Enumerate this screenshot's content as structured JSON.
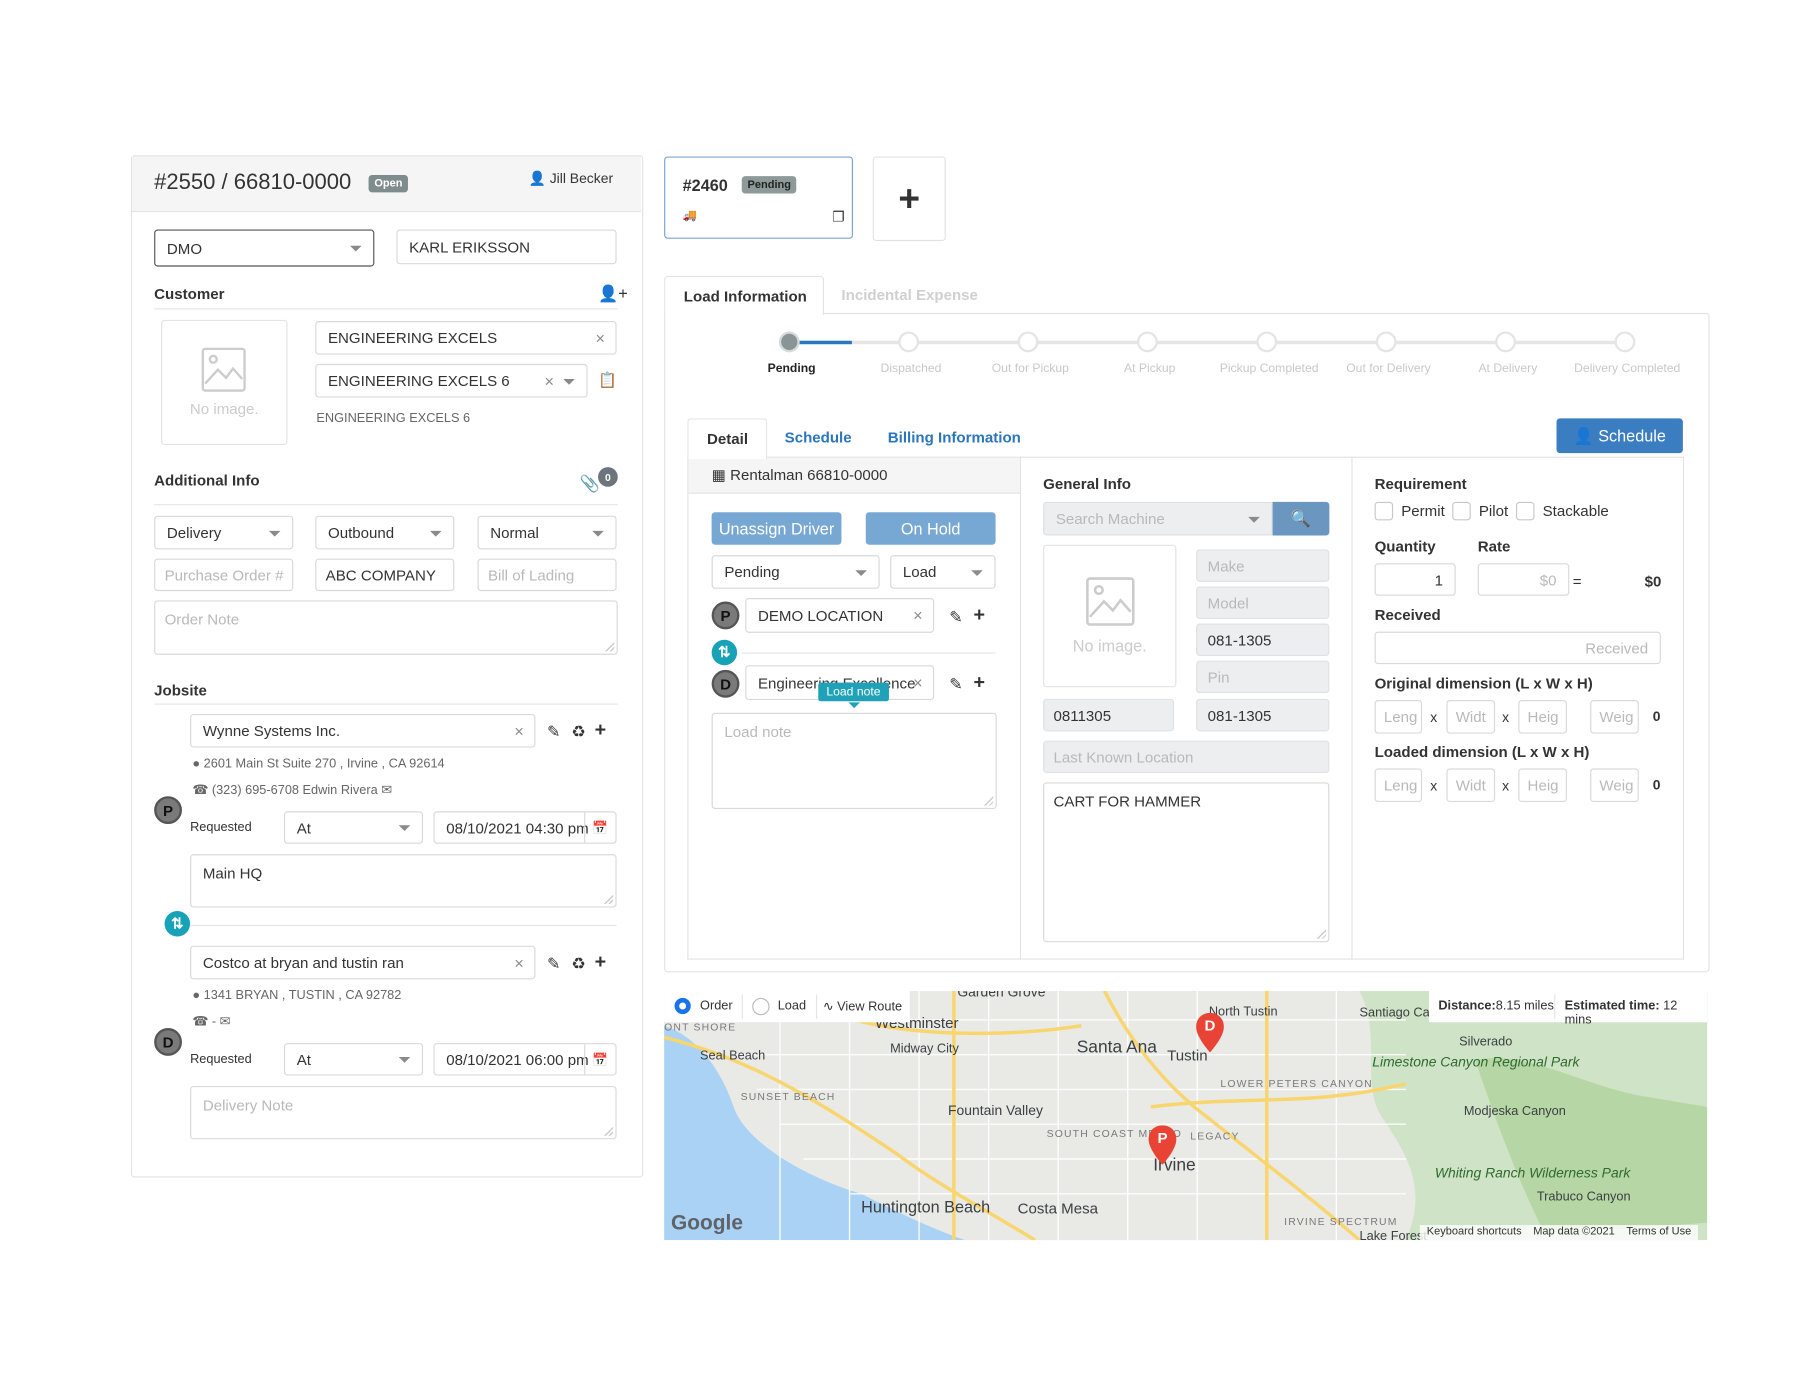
{
  "order": {
    "title": "#2550 / 66810-0000",
    "status_badge": "Open",
    "assigned_user": "Jill Becker",
    "branch_select": "DMO",
    "salesperson": "KARL ERIKSSON",
    "customer_label": "Customer",
    "no_image_text": "No image.",
    "customer_name": "ENGINEERING EXCELS",
    "customer_contact": "ENGINEERING EXCELS 6",
    "customer_contact_caption": "ENGINEERING EXCELS 6",
    "additional_info_label": "Additional Info",
    "attachments_count": "0",
    "order_type": "Delivery",
    "direction": "Outbound",
    "priority": "Normal",
    "po_placeholder": "Purchase Order #",
    "company": "ABC COMPANY",
    "bol_placeholder": "Bill of Lading",
    "order_note_placeholder": "Order Note",
    "jobsite_label": "Jobsite",
    "pickup": {
      "marker": "P",
      "name": "Wynne Systems Inc.",
      "address": "2601 Main St Suite 270 , Irvine , CA 92614",
      "phone_contact": "(323) 695-6708 Edwin Rivera",
      "requested_label": "Requested",
      "time_mode": "At",
      "datetime": "08/10/2021 04:30 pm",
      "note": "Main HQ"
    },
    "delivery": {
      "marker": "D",
      "name": "Costco at bryan and tustin ran",
      "address": "1341 BRYAN , TUSTIN , CA 92782",
      "phone_contact": "-",
      "requested_label": "Requested",
      "time_mode": "At",
      "datetime": "08/10/2021 06:00 pm",
      "note_placeholder": "Delivery Note"
    }
  },
  "load_card": {
    "id": "#2460",
    "status_badge": "Pending",
    "add_label": "+"
  },
  "load_tabs": [
    "Load Information",
    "Incidental Expense"
  ],
  "progress": {
    "steps": [
      "Pending",
      "Dispatched",
      "Out for Pickup",
      "At Pickup",
      "Pickup Completed",
      "Out for Delivery",
      "At Delivery",
      "Delivery Completed"
    ],
    "current_index": 0
  },
  "detail_tabs": [
    "Detail",
    "Schedule",
    "Billing Information"
  ],
  "schedule_button": "Schedule",
  "detail": {
    "rental_ref": "Rentalman 66810-0000",
    "unassign_driver": "Unassign Driver",
    "on_hold": "On Hold",
    "status_select": "Pending",
    "type_select": "Load",
    "pickup_marker": "P",
    "pickup_location": "DEMO LOCATION",
    "delivery_marker": "D",
    "delivery_location": "Engineering Excellence",
    "tooltip": "Load note",
    "load_note_placeholder": "Load note"
  },
  "general_info": {
    "label": "General Info",
    "search_placeholder": "Search Machine",
    "no_image_text": "No image.",
    "make_placeholder": "Make",
    "model_placeholder": "Model",
    "serial": "081-1305",
    "pin_placeholder": "Pin",
    "equipment_no": "0811305",
    "equipment_code": "081-1305",
    "last_location_placeholder": "Last Known Location",
    "description": "CART FOR HAMMER"
  },
  "requirement": {
    "label": "Requirement",
    "options": [
      "Permit",
      "Pilot",
      "Stackable"
    ],
    "quantity_label": "Quantity",
    "rate_label": "Rate",
    "quantity": "1",
    "rate_placeholder": "$0",
    "equals": "=",
    "total": "$0",
    "received_label": "Received",
    "received_placeholder": "Received",
    "original_dim_label": "Original dimension (L x W x H)",
    "loaded_dim_label": "Loaded dimension (L x W x H)",
    "dim_placeholders": [
      "Leng",
      "Widt",
      "Heig",
      "Weig"
    ],
    "x": "x",
    "original_total": "0",
    "loaded_total": "0"
  },
  "map": {
    "radio_order": "Order",
    "radio_load": "Load",
    "view_route": "View Route",
    "distance_label": "Distance:",
    "distance_value": "8.15 miles",
    "time_label": "Estimated time:",
    "time_value": " 12 mins",
    "places": [
      "Garden Grove",
      "Westminster",
      "Midway City",
      "Seal Beach",
      "Santa Ana",
      "Tustin",
      "North Tustin",
      "Santiago Canyon",
      "Silverado",
      "Limestone Canyon Regional Park",
      "Fountain Valley",
      "Irvine",
      "Modjeska Canyon",
      "Whiting Ranch Wilderness Park",
      "Trabuco Canyon",
      "Huntington Beach",
      "Costa Mesa",
      "Lake Forest"
    ],
    "districts": [
      "ONT SHORE",
      "SUNSET BEACH",
      "LOWER PETERS CANYON",
      "SOUTH COAST METRO",
      "LEGACY",
      "IRVINE SPECTRUM"
    ],
    "markers": [
      "P",
      "D"
    ],
    "attribution": [
      "Keyboard shortcuts",
      "Map data ©2021",
      "Terms of Use"
    ],
    "logo": "Google"
  }
}
